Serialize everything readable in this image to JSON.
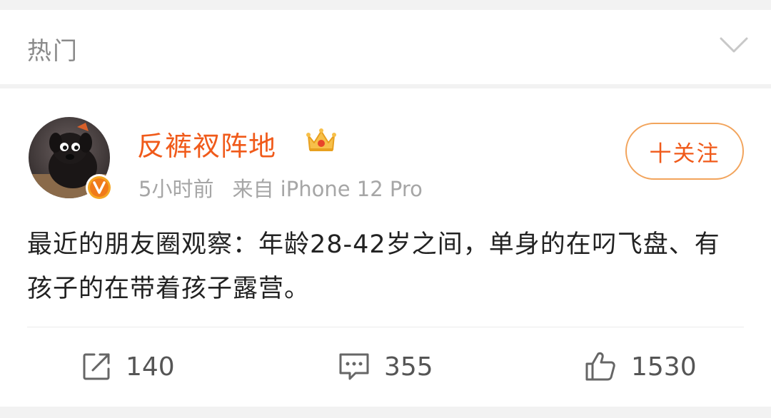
{
  "header": {
    "title": "热门",
    "chevron_icon": "chevron-down-icon"
  },
  "post": {
    "username": "反裤衩阵地",
    "username_color": "#f05a1a",
    "badge_icon": "crown-icon",
    "verified_icon": "v-verified-icon",
    "time": "5小时前",
    "source": "来自 iPhone 12 Pro",
    "follow_label": "十关注",
    "text": "最近的朋友圈观察：年龄28-42岁之间，单身的在叼飞盘、有孩子的在带着孩子露营。"
  },
  "actions": {
    "repost_count": "140",
    "comment_count": "355",
    "like_count": "1530"
  },
  "colors": {
    "accent": "#f05a1a",
    "follow_border": "#f2a45c",
    "muted_text": "#a6a6a6"
  }
}
